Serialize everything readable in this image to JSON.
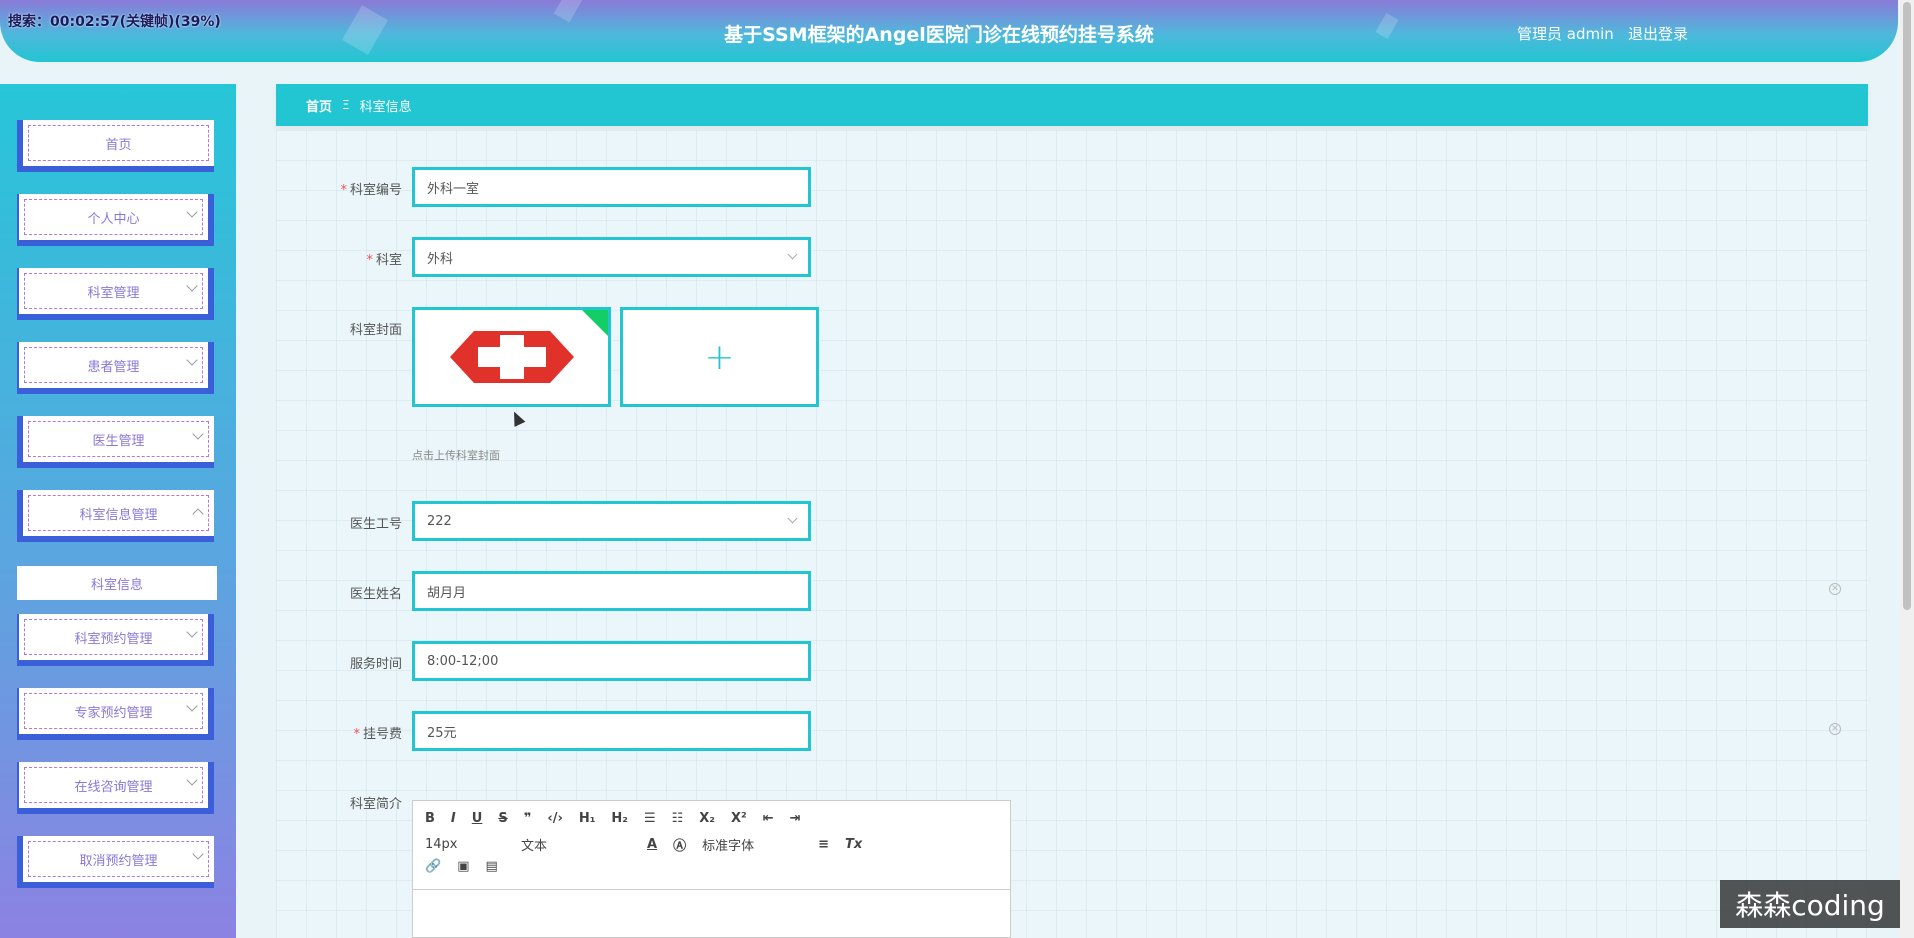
{
  "header": {
    "timer": "搜索：00:02:57(关键帧)(39%)",
    "title": "基于SSM框架的Angel医院门诊在线预约挂号系统",
    "user": "管理员 admin",
    "logout": "退出登录"
  },
  "sidebar": {
    "items": [
      {
        "label": "首页"
      },
      {
        "label": "个人中心"
      },
      {
        "label": "科室管理"
      },
      {
        "label": "患者管理"
      },
      {
        "label": "医生管理"
      },
      {
        "label": "科室信息管理"
      },
      {
        "label": "科室预约管理"
      },
      {
        "label": "专家预约管理"
      },
      {
        "label": "在线咨询管理"
      },
      {
        "label": "取消预约管理"
      }
    ],
    "submenu_label": "科室信息"
  },
  "breadcrumb": {
    "home": "首页",
    "separator": "Ξ",
    "current": "科室信息"
  },
  "form": {
    "dept_no": {
      "label": "科室编号",
      "value": "外科一室"
    },
    "dept": {
      "label": "科室",
      "value": "外科"
    },
    "cover": {
      "label": "科室封面",
      "hint": "点击上传科室封面"
    },
    "doctor_no": {
      "label": "医生工号",
      "value": "222"
    },
    "doctor_name": {
      "label": "医生姓名",
      "value": "胡月月"
    },
    "service_time": {
      "label": "服务时间",
      "value": "8:00-12;00"
    },
    "fee": {
      "label": "挂号费",
      "value": "25元"
    },
    "intro": {
      "label": "科室简介"
    }
  },
  "editor": {
    "font_size": "14px",
    "text_type": "文本",
    "font_family": "标准字体"
  },
  "watermark": "森森coding",
  "colors": {
    "accent": "#22c5d2",
    "required": "#ee5555",
    "menu_text": "#8a78d6"
  }
}
